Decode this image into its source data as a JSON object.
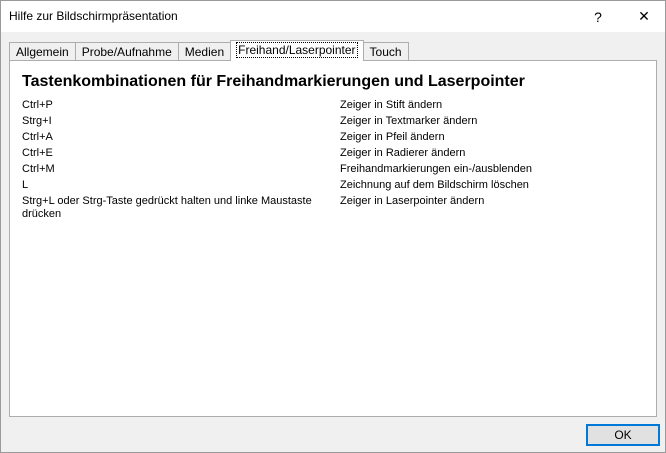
{
  "window": {
    "title": "Hilfe zur Bildschirmpräsentation",
    "help_label": "?",
    "close_label": "✕"
  },
  "tabs": [
    {
      "label": "Allgemein",
      "active": false
    },
    {
      "label": "Probe/Aufnahme",
      "active": false
    },
    {
      "label": "Medien",
      "active": false
    },
    {
      "label": "Freihand/Laserpointer",
      "active": true
    },
    {
      "label": "Touch",
      "active": false
    }
  ],
  "panel": {
    "title": "Tastenkombinationen für Freihandmarkierungen und Laserpointer",
    "shortcuts": [
      {
        "keys": "Ctrl+P",
        "action": "Zeiger in Stift ändern"
      },
      {
        "keys": "Strg+I",
        "action": "Zeiger in Textmarker ändern"
      },
      {
        "keys": "Ctrl+A",
        "action": "Zeiger in Pfeil ändern"
      },
      {
        "keys": "Ctrl+E",
        "action": "Zeiger in Radierer ändern"
      },
      {
        "keys": "Ctrl+M",
        "action": "Freihandmarkierungen ein-/ausblenden"
      },
      {
        "keys": "L",
        "action": "Zeichnung auf dem Bildschirm löschen"
      },
      {
        "keys": "Strg+L oder Strg-Taste gedrückt halten und linke Maustaste drücken",
        "action": "Zeiger in Laserpointer ändern"
      }
    ]
  },
  "footer": {
    "ok_label": "OK"
  }
}
